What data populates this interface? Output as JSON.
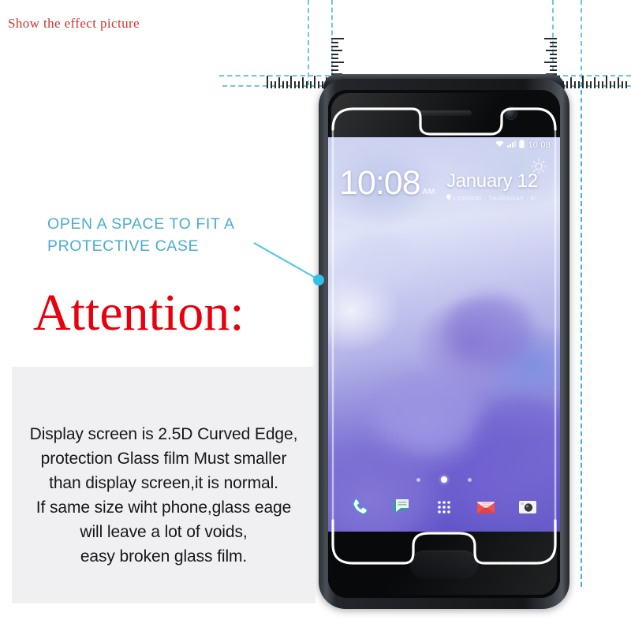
{
  "header": {
    "show_effect_label": "Show the effect picture",
    "show_effect_color": "#d2322d"
  },
  "annotation": {
    "line1": "OPEN A SPACE TO FIT A",
    "line2": "PROTECTIVE CASE",
    "color": "#4cacd0"
  },
  "attention": {
    "label": "Attention:",
    "color": "#e8000d"
  },
  "note": {
    "lines": [
      "Display screen is 2.5D Curved Edge,",
      "protection Glass film Must smaller",
      "than display screen,it is normal.",
      "If same size wiht phone,glass eage",
      "will leave a lot of voids,",
      "easy broken glass film."
    ],
    "background": "#f0f0f2",
    "text_color": "#15171a"
  },
  "guides": {
    "dash_color": "#6ec6e0",
    "ruler_tick_color": "#2b2b2b"
  },
  "phone": {
    "status_bar": {
      "wifi_icon": "wifi-icon",
      "signal_icon": "signal-bars-icon",
      "battery_icon": "battery-icon",
      "time": "10:08"
    },
    "lockscreen": {
      "clock": "10:08",
      "ampm": "AM",
      "date": "January 12",
      "location_icon": "location-pin-icon",
      "subline": "LONDON · THURSDAY · 5°",
      "weather_icon": "sun-icon"
    },
    "page_dots": [
      {
        "active": false
      },
      {
        "active": true
      },
      {
        "active": false
      }
    ],
    "dock": [
      {
        "name": "phone-icon",
        "label": "Phone"
      },
      {
        "name": "messages-icon",
        "label": "Messages"
      },
      {
        "name": "app-drawer-icon",
        "label": "Apps"
      },
      {
        "name": "gmail-icon",
        "label": "Gmail"
      },
      {
        "name": "camera-icon",
        "label": "Camera"
      }
    ],
    "hardware": {
      "earpiece": "earpiece-speaker",
      "front_camera": "front-camera-icon",
      "home_button": "home-button"
    }
  }
}
